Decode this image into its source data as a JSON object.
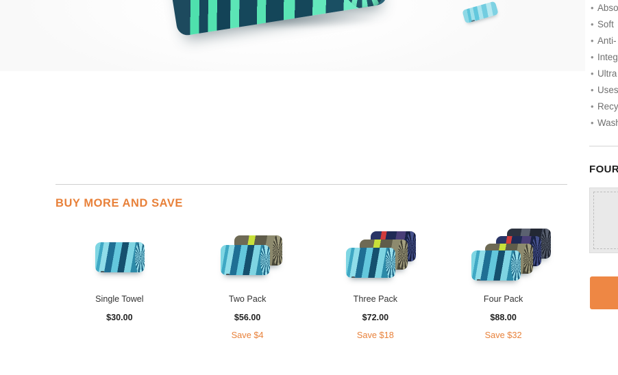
{
  "hero": {
    "main_image_alt": "rolled-beach-towel",
    "thumbnail_alt": "rolled-towel-thumbnail"
  },
  "bundles_section": {
    "title": "BUY MORE AND SAVE",
    "title_color": "#E8813A",
    "items": [
      {
        "name": "Single Towel",
        "price": "$30.00",
        "save": "",
        "image_alt": "single-rolled-towel"
      },
      {
        "name": "Two Pack",
        "price": "$56.00",
        "save": "Save $4",
        "image_alt": "two-rolled-towels"
      },
      {
        "name": "Three Pack",
        "price": "$72.00",
        "save": "Save $18",
        "image_alt": "three-rolled-towels"
      },
      {
        "name": "Four Pack",
        "price": "$88.00",
        "save": "Save $32",
        "image_alt": "four-rolled-towels"
      }
    ]
  },
  "sidebar": {
    "features": [
      "Abso",
      "Soft",
      "Anti-",
      "Integ",
      "Ultra",
      "Uses",
      "Recy",
      "Wash"
    ],
    "heading": "FOUR",
    "image_placeholder_alt": "product-image-placeholder",
    "cta_label": "",
    "cta_color": "#EE8744"
  }
}
